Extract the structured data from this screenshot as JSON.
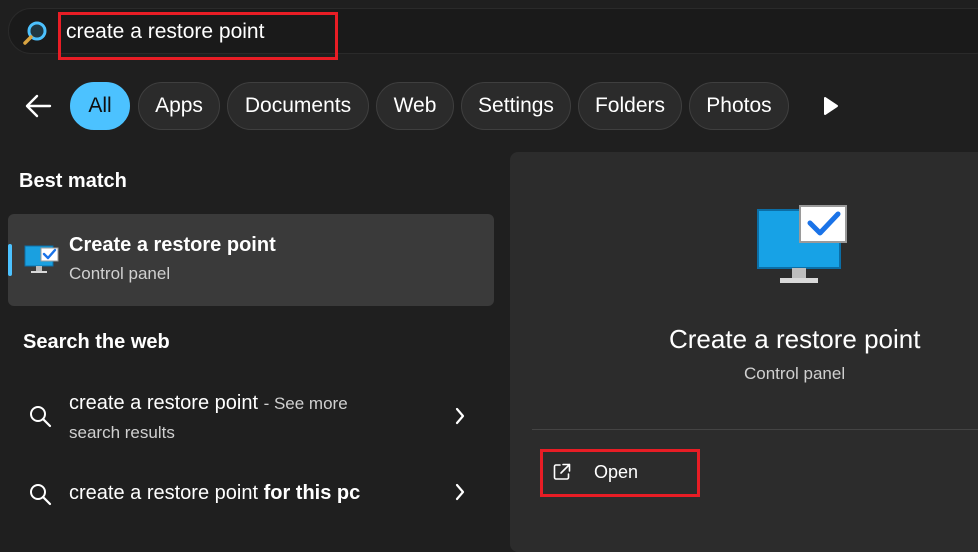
{
  "search": {
    "query": "create a restore point",
    "icon": "search-icon"
  },
  "filters": {
    "items": [
      "All",
      "Apps",
      "Documents",
      "Web",
      "Settings",
      "Folders",
      "Photos"
    ],
    "active": "All",
    "back_icon": "back-arrow-icon",
    "more_icon": "play-more-icon"
  },
  "best_match": {
    "section_title": "Best match",
    "title": "Create a restore point",
    "subtitle": "Control panel",
    "icon": "monitor-checkmark-icon"
  },
  "web": {
    "section_title": "Search the web",
    "results": [
      {
        "query": "create a restore point",
        "suffix": "- See more",
        "second_line": "search results",
        "icon": "search-icon"
      },
      {
        "query": "create a restore point",
        "bold_suffix": "for this pc",
        "icon": "search-icon"
      }
    ]
  },
  "preview": {
    "title": "Create a restore point",
    "subtitle": "Control panel",
    "action_label": "Open",
    "action_icon": "open-external-icon"
  },
  "colors": {
    "accent": "#4cc2ff",
    "highlight": "#e81d25",
    "background": "#1f1f1f"
  }
}
